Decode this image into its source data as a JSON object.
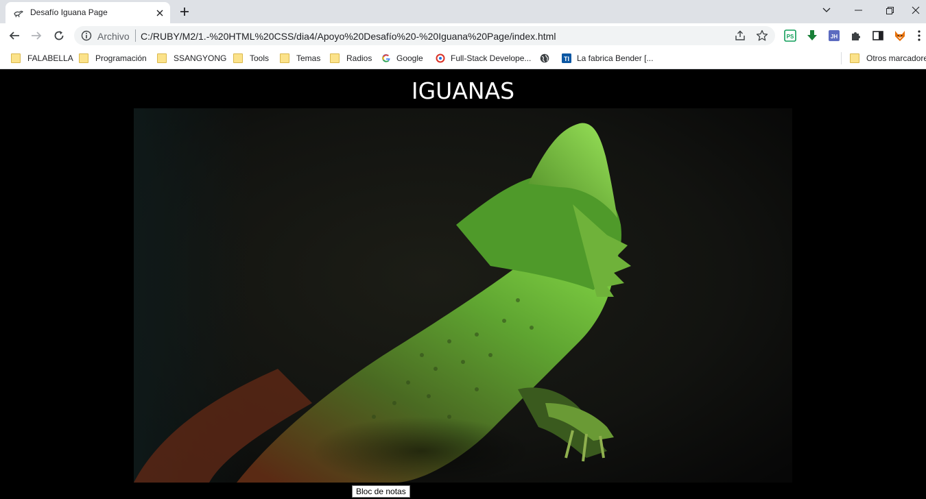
{
  "browser": {
    "tab": {
      "title": "Desafío Iguana Page"
    },
    "omnibox": {
      "scheme_label": "Archivo",
      "url": "C:/RUBY/M2/1.-%20HTML%20CSS/dia4/Apoyo%20Desafío%20-%20Iguana%20Page/index.html"
    },
    "extensions": [
      {
        "name": "ps-extension-icon",
        "label": "PS",
        "color": "#0f9d58"
      },
      {
        "name": "download-arrow-icon",
        "color": "#188038"
      },
      {
        "name": "jh-extension-icon",
        "label": "JH",
        "color": "#5c6bc0"
      },
      {
        "name": "puzzle-icon",
        "color": "#5f6368"
      },
      {
        "name": "sidepanel-icon",
        "color": "#202124"
      },
      {
        "name": "fox-extension-icon",
        "color": "#e8710a"
      }
    ]
  },
  "bookmarks": {
    "items": [
      {
        "label": "FALABELLA",
        "icon": "folder-icon"
      },
      {
        "label": "Programación",
        "icon": "folder-icon"
      },
      {
        "label": "SSANGYONG",
        "icon": "folder-icon"
      },
      {
        "label": "Tools",
        "icon": "folder-icon"
      },
      {
        "label": "Temas",
        "icon": "folder-icon"
      },
      {
        "label": "Radios",
        "icon": "folder-icon"
      },
      {
        "label": "Google",
        "icon": "google-icon"
      },
      {
        "label": "Full-Stack Develope...",
        "icon": "fullstack-icon"
      },
      {
        "label": "",
        "icon": "globe-icon"
      },
      {
        "label": "La fabrica Bender [...",
        "icon": "bender-icon"
      }
    ],
    "other": "Otros marcadores"
  },
  "page": {
    "heading": "IGUANAS"
  },
  "tooltip": {
    "text": "Bloc de notas"
  }
}
